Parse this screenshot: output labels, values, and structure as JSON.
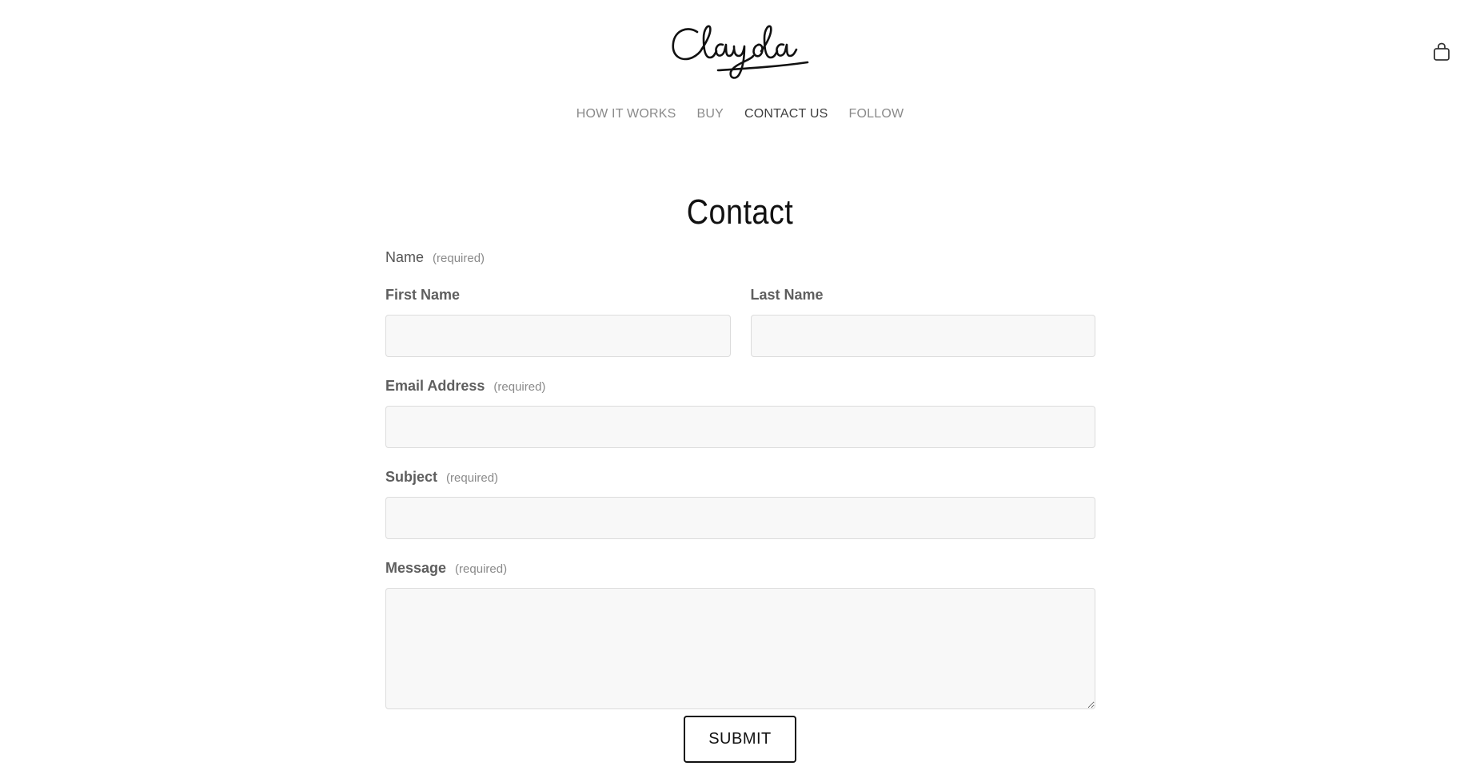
{
  "brand": {
    "logo_text": "Clayola"
  },
  "header": {
    "cart_icon": "shopping-bag-icon"
  },
  "nav": {
    "items": [
      {
        "label": "HOW IT WORKS"
      },
      {
        "label": "BUY"
      },
      {
        "label": "CONTACT US"
      },
      {
        "label": "FOLLOW"
      }
    ],
    "active_index": 2
  },
  "page": {
    "title": "Contact"
  },
  "form": {
    "name": {
      "label": "Name",
      "required": "(required)",
      "first_label": "First Name",
      "first_value": "",
      "last_label": "Last Name",
      "last_value": ""
    },
    "email": {
      "label": "Email Address",
      "required": "(required)",
      "value": ""
    },
    "subject": {
      "label": "Subject",
      "required": "(required)",
      "value": ""
    },
    "message": {
      "label": "Message",
      "required": "(required)",
      "value": ""
    },
    "submit_label": "SUBMIT"
  },
  "colors": {
    "background": "#ffffff",
    "nav_text": "#8a8a8a",
    "nav_active": "#3f3f3f",
    "field_bg": "#f8f8f8",
    "field_border": "#dcdcdc",
    "label_text": "#5e5e5e"
  }
}
